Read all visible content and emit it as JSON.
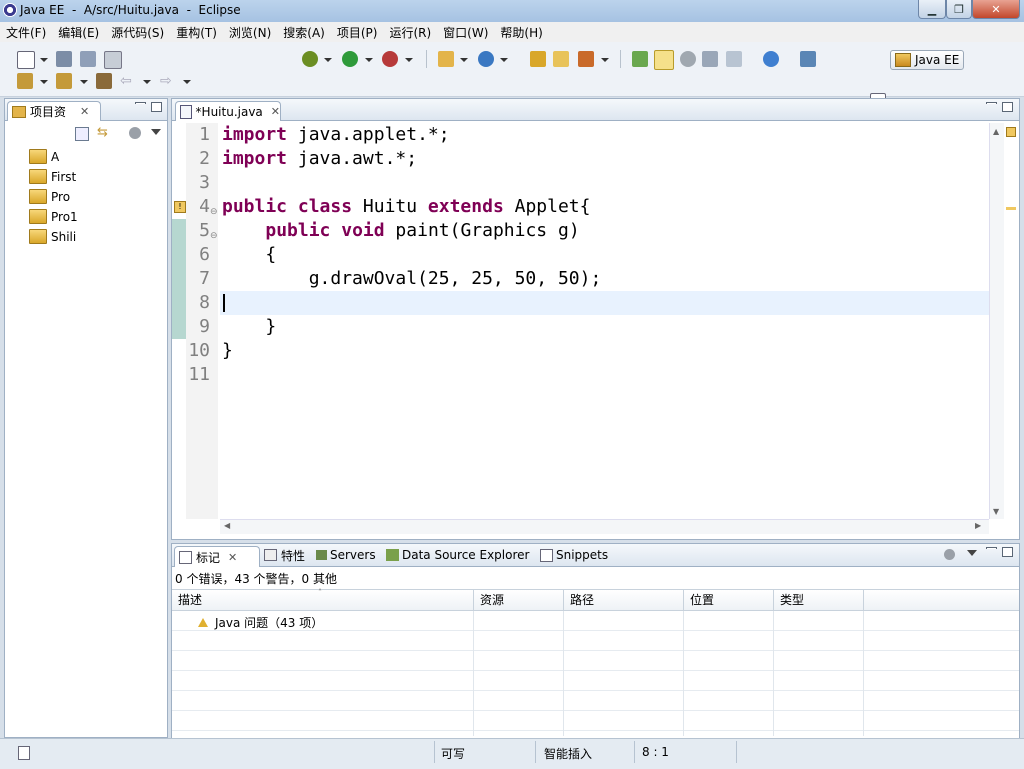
{
  "window": {
    "title": "Java EE  -  A/src/Huitu.java  -  Eclipse"
  },
  "menu": [
    "文件(F)",
    "编辑(E)",
    "源代码(S)",
    "重构(T)",
    "浏览(N)",
    "搜索(A)",
    "项目(P)",
    "运行(R)",
    "窗口(W)",
    "帮助(H)"
  ],
  "perspective": {
    "label": "Java EE"
  },
  "project_explorer": {
    "title": "项目资",
    "items": [
      "A",
      "First",
      "Pro",
      "Pro1",
      "Shili"
    ]
  },
  "editor": {
    "tab": "*Huitu.java",
    "lines": [
      {
        "n": "1",
        "text": "import java.applet.*;"
      },
      {
        "n": "2",
        "text": "import java.awt.*;"
      },
      {
        "n": "3",
        "text": ""
      },
      {
        "n": "4",
        "text": "public class Huitu extends Applet{"
      },
      {
        "n": "5",
        "text": "    public void paint(Graphics g)"
      },
      {
        "n": "6",
        "text": "    {"
      },
      {
        "n": "7",
        "text": "        g.drawOval(25, 25, 50, 50);"
      },
      {
        "n": "8",
        "text": ""
      },
      {
        "n": "9",
        "text": "    }"
      },
      {
        "n": "10",
        "text": "}"
      },
      {
        "n": "11",
        "text": ""
      }
    ],
    "current_line": "8"
  },
  "bottom_tabs": [
    "标记",
    "特性",
    "Servers",
    "Data Source Explorer",
    "Snippets"
  ],
  "markers": {
    "summary": "0 个错误，43 个警告，0 其他",
    "columns": [
      "描述",
      "资源",
      "路径",
      "位置",
      "类型"
    ],
    "rows": [
      {
        "desc": "Java 问题（43 项）",
        "res": "",
        "path": "",
        "loc": "",
        "type": ""
      }
    ]
  },
  "status": {
    "writable": "可写",
    "insert_mode": "智能插入",
    "position": "8 : 1"
  },
  "colors": {
    "keyword": "#7f0055",
    "line_number": "#808080",
    "current_line_bg": "#e8f2fe"
  }
}
